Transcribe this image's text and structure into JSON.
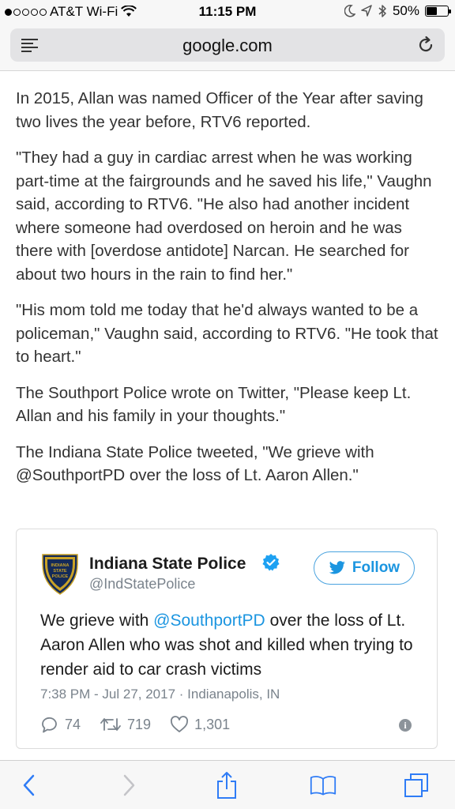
{
  "status_bar": {
    "carrier": "AT&T Wi-Fi",
    "time": "11:15 PM",
    "battery": "50%",
    "battery_level": 0.5
  },
  "browser": {
    "url": "google.com",
    "icons": [
      "reader-icon",
      "reload-icon"
    ]
  },
  "article": {
    "paragraphs": [
      "In 2015, Allan was named Officer of the Year after saving two lives the year before, RTV6 reported.",
      "\"They had a guy in cardiac arrest when he was working part-time at the fairgrounds and he saved his life,\" Vaughn said, according to RTV6. \"He also had another incident where someone had overdosed on heroin and he was there with [overdose antidote] Narcan. He searched for about two hours in the rain to find her.\"",
      "\"His mom told me today that he'd always wanted to be a policeman,\" Vaughn said, according to RTV6. \"He took that to heart.\"",
      "The Southport Police wrote on Twitter, \"Please keep Lt. Allan and his family in your thoughts.\"",
      "The Indiana State Police tweeted, \"We grieve with @SouthportPD over the loss of Lt. Aaron Allen.\""
    ]
  },
  "tweet": {
    "logo_text": "INDIANA STATE POLICE",
    "name": "Indiana State Police",
    "handle": "@IndStatePolice",
    "follow_label": "Follow",
    "text_before": "We grieve with ",
    "mention": "@SouthportPD",
    "text_after": " over the loss of Lt. Aaron Allen who was shot and killed when trying to render aid to car crash victims",
    "meta": "7:38 PM - Jul 27, 2017 · Indianapolis, IN",
    "replies": "74",
    "retweets": "719",
    "likes": "1,301",
    "accent_color": "#1b95e0"
  },
  "toolbar": {
    "icons": [
      "back-icon",
      "forward-icon",
      "share-icon",
      "bookmarks-icon",
      "tabs-icon"
    ],
    "accent_color": "#2f7cf6"
  }
}
